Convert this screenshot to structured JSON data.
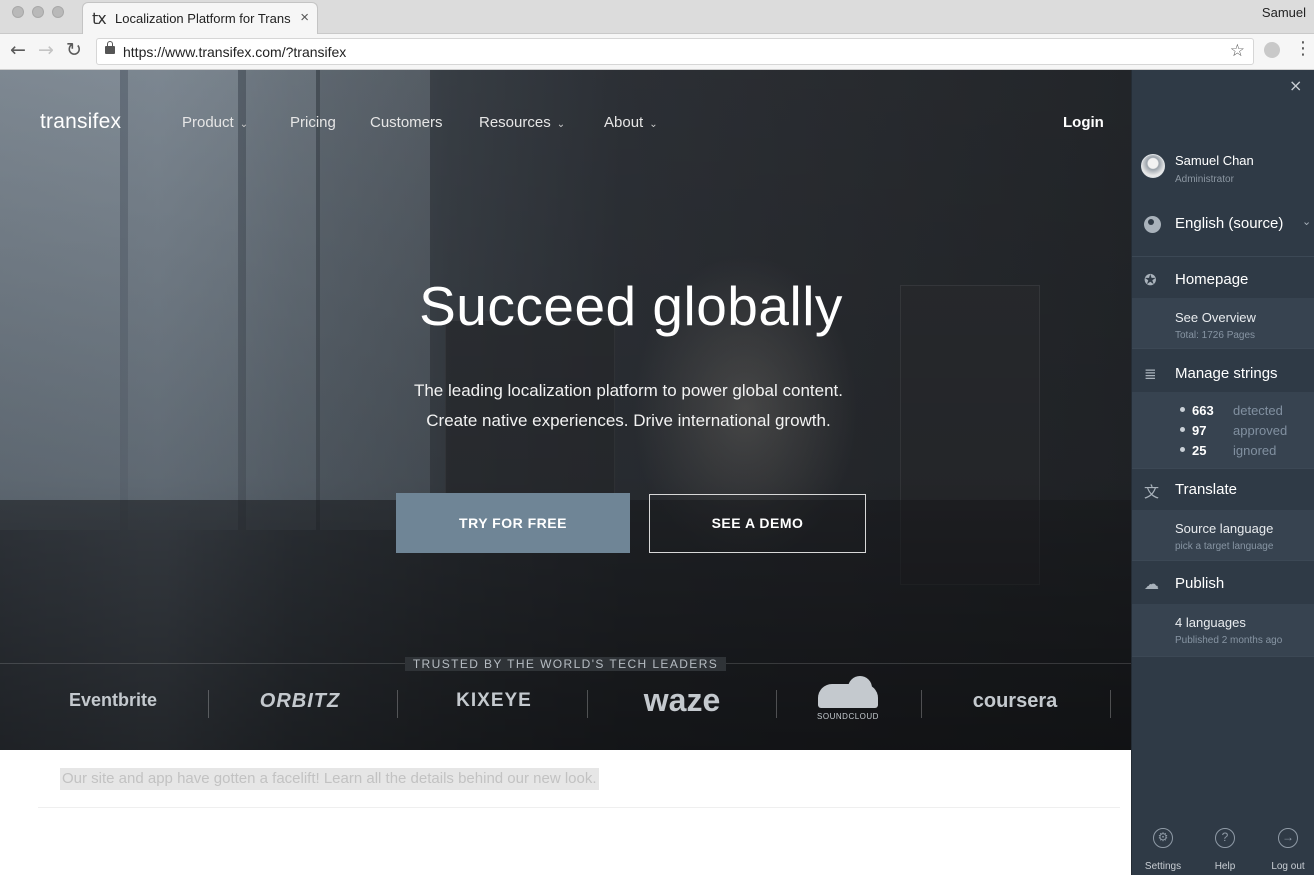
{
  "browser": {
    "tab_logo": "tx",
    "tab_title": "Localization Platform for Translation",
    "tab_close": "×",
    "profile_name": "Samuel",
    "url": "https://www.transifex.com/?transifex",
    "back": "←",
    "forward": "→",
    "reload": "↻",
    "star": "☆",
    "menu": "⋮"
  },
  "site": {
    "logo": "transifex",
    "nav": {
      "product": "Product",
      "pricing": "Pricing",
      "customers": "Customers",
      "resources": "Resources",
      "about": "About",
      "login": "Login"
    },
    "caret": "⌄",
    "hero": {
      "headline": "Succeed globally",
      "sub_line1": "The leading localization platform to power global content.",
      "sub_line2": "Create native experiences. Drive international growth.",
      "cta_primary": "TRY FOR FREE",
      "cta_secondary": "SEE A DEMO"
    },
    "trusted": {
      "heading": "TRUSTED BY THE WORLD'S TECH LEADERS",
      "brands": [
        "Eventbrite",
        "ORBITZ",
        "KIXEYE",
        "waze",
        "SOUNDCLOUD",
        "coursera"
      ]
    },
    "notice": "Our site and app have gotten a facelift! Learn all the details behind our new look."
  },
  "panel": {
    "close": "×",
    "user": {
      "name": "Samuel Chan",
      "role": "Administrator"
    },
    "language": "English (source)",
    "language_caret": "⌄",
    "sections": {
      "homepage": {
        "title": "Homepage",
        "link": "See Overview",
        "meta": "Total: 1726 Pages"
      },
      "manage": {
        "title": "Manage strings",
        "stats": [
          {
            "value": "663",
            "label": "detected"
          },
          {
            "value": "97",
            "label": "approved"
          },
          {
            "value": "25",
            "label": "ignored"
          }
        ]
      },
      "translate": {
        "title": "Translate",
        "link": "Source language",
        "meta": "pick a target language"
      },
      "publish": {
        "title": "Publish",
        "link": "4 languages",
        "meta": "Published 2 months ago"
      }
    },
    "icons": {
      "compass": "✪",
      "list": "≣",
      "translate": "文",
      "cloud": "☁"
    },
    "footer": {
      "settings": {
        "label": "Settings",
        "glyph": "⚙"
      },
      "help": {
        "label": "Help",
        "glyph": "?"
      },
      "logout": {
        "label": "Log out",
        "glyph": "→"
      }
    }
  }
}
